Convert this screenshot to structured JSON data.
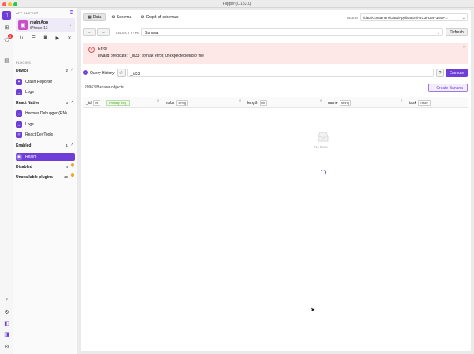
{
  "window": {
    "title": "Flipper (0.153.0)"
  },
  "left_rail": {
    "badge_count": "3"
  },
  "sidebar": {
    "app_inspect_label": "APP INSPECT",
    "device": {
      "app": "realmApp",
      "name": "iPhone 13"
    },
    "plugins_label": "PLUGINS",
    "sections": [
      {
        "label": "Device",
        "count": "2",
        "items": [
          {
            "label": "Crash Reporter"
          },
          {
            "label": "Logs"
          }
        ]
      },
      {
        "label": "React Native",
        "count": "3",
        "items": [
          {
            "label": "Hermes Debugger (RN)"
          },
          {
            "label": "Logs"
          },
          {
            "label": "React DevTools"
          }
        ]
      },
      {
        "label": "Enabled",
        "count": "1",
        "items": [
          {
            "label": "Realm"
          }
        ]
      },
      {
        "label": "Disabled",
        "count": "4"
      },
      {
        "label": "Unavailable plugins",
        "count": "10"
      }
    ]
  },
  "main": {
    "tabs": [
      {
        "label": "Data"
      },
      {
        "label": "Schema"
      },
      {
        "label": "Graph of schemas"
      }
    ],
    "realm_label": "REALM",
    "realm_path": "/data/Containers/Data/Application/F4C3FD98-3849-...",
    "object_type_label": "OBJECT TYPE",
    "object_type_value": "Banana",
    "refresh_label": "Refresh",
    "error": {
      "title": "Error",
      "message": "Invalid predicate: '_id33': syntax error, unexpected end of file"
    },
    "query_history_label": "Query History",
    "query_value": "_id33",
    "help_label": "?",
    "execute_label": "Execute",
    "object_count": "20963 Banana objects",
    "create_label": "+ Create Banana",
    "columns": [
      {
        "name": "_id",
        "type": "int",
        "tag": "Primary Key"
      },
      {
        "name": "color",
        "type": "string"
      },
      {
        "name": "length",
        "type": "int"
      },
      {
        "name": "name",
        "type": "string"
      },
      {
        "name": "task",
        "type": "Task?"
      }
    ],
    "no_data_label": "No Data"
  }
}
